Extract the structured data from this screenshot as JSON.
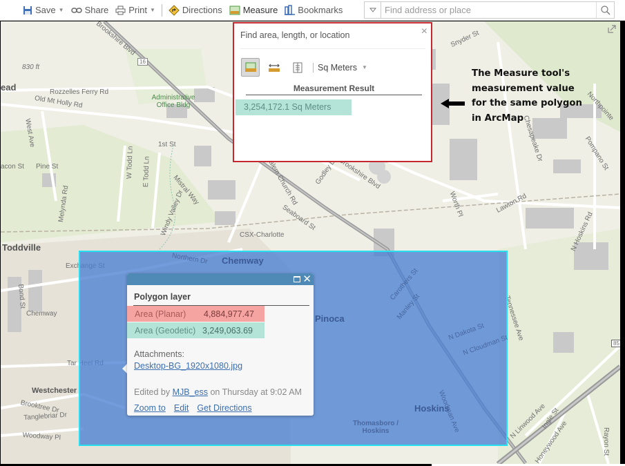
{
  "toolbar": {
    "items": [
      {
        "label": "Save",
        "icon": "save-icon",
        "has_caret": true
      },
      {
        "label": "Share",
        "icon": "share-link-icon",
        "has_caret": false
      },
      {
        "label": "Print",
        "icon": "printer-icon",
        "has_caret": true
      },
      {
        "label": "Directions",
        "icon": "directions-icon",
        "has_caret": false
      },
      {
        "label": "Measure",
        "icon": "measure-icon",
        "has_caret": false
      },
      {
        "label": "Bookmarks",
        "icon": "bookmarks-icon",
        "has_caret": false
      }
    ],
    "search": {
      "placeholder": "Find address or place",
      "value": ""
    }
  },
  "measure_panel": {
    "header": "Find area, length, or location",
    "close": "×",
    "tools": [
      {
        "name": "area",
        "icon": "area-measure-icon",
        "active": true
      },
      {
        "name": "distance",
        "icon": "distance-measure-icon",
        "active": false
      },
      {
        "name": "location",
        "icon": "location-measure-icon",
        "active": false
      }
    ],
    "unit": "Sq Meters",
    "result_title": "Measurement Result",
    "result_value": "3,254,172.1 Sq Meters",
    "result_color": "#b4e4d8"
  },
  "annotation": {
    "text": "The Measure tool's measurement value for the same polygon in ArcMap"
  },
  "popup": {
    "title": "Polygon layer",
    "attributes": [
      {
        "key": "Area (Planar)",
        "value": "4,884,977.47",
        "highlight": "#f5a4a1"
      },
      {
        "key": "Area (Geodetic)",
        "value": "3,249,063.69",
        "highlight": "#b4e4d8"
      }
    ],
    "attachments_label": "Attachments:",
    "attachment_file": "Desktop-BG_1920x1080.jpg",
    "edited_prefix": "Edited by ",
    "edited_user": "MJB_ess",
    "edited_suffix": " on Thursday at 9:02 AM",
    "actions": [
      "Zoom to",
      "Edit",
      "Get Directions"
    ]
  },
  "map": {
    "polygon_fill": "#4a80d2",
    "polygon_outline": "#27e0ef",
    "labels": {
      "brookshire_top": "Brookshire Blvd",
      "hwy16": "16",
      "ft830": "830 ft",
      "ead": "ead",
      "rozzelles": "Rozzelles Ferry Rd",
      "old_mt_holly": "Old Mt Holly Rd",
      "admin": "Administrative Office Bldg",
      "west_ave": "West Ave",
      "first_st": "1st St",
      "acon": "acon St",
      "pine": "Pine St",
      "w_todd": "W Todd Ln",
      "e_todd": "E Todd Ln",
      "melynda": "Melynda Rd",
      "mistral": "Mistral Way",
      "windy": "Windy Valley Dr",
      "salem": "Salem Church Rd",
      "godley": "Godley Ln",
      "brookshire_mid": "Brookshire Blvd",
      "seaboard": "Seaboard St",
      "csx": "CSX-Charlotte",
      "toddville": "Toddville",
      "exchange": "Exchange St",
      "bond": "Bond St",
      "chemway_left": "Chemway",
      "tarheel": "Tar Heel Rd",
      "westchester": "Westchester",
      "brooktree": "Brooktree Dr",
      "tanglebriar": "Tanglebriar Dr",
      "woodway": "Woodway Pl",
      "northern": "Northern Dr",
      "chemway_poly": "Chemway",
      "pinoca": "Pinoca",
      "hoskins": "Hoskins",
      "thomasboro": "Thomasboro / Hoskins",
      "hwy16b": "16",
      "n_dakota": "N Dakota St",
      "n_cloudman": "N Cloudman St",
      "carothers": "Carothers St",
      "manley": "Manley St",
      "woodman": "Woodman Ave",
      "snyder": "Snyder St",
      "northpointe": "Northpointe",
      "chesapeake": "Chesapeake Dr",
      "pompano": "Pompano St",
      "lawton": "Lawton Rd",
      "worth": "Worth Pl",
      "n_hoskins": "N Hoskins Rd",
      "tennessee": "Tennessee Ave",
      "n_linwood": "N Linwood Ave",
      "ingle": "Ingle St",
      "honeywood": "Honeywood Ave",
      "rayon": "Rayon St",
      "hwy85": "85"
    }
  }
}
